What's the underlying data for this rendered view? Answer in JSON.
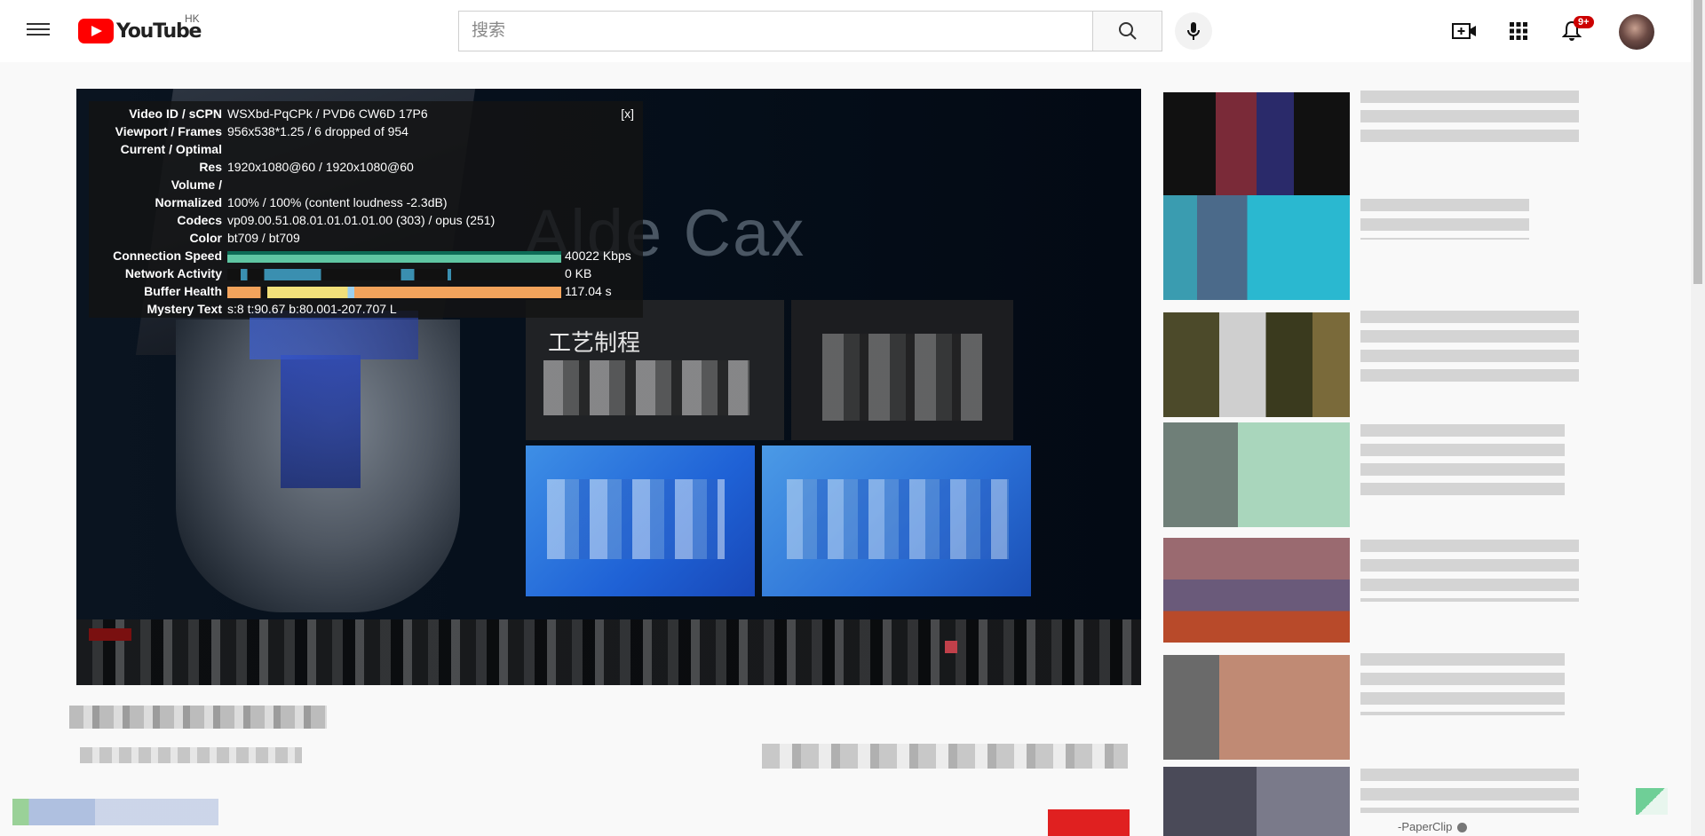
{
  "header": {
    "logo_text": "YouTube",
    "region_code": "HK",
    "search_placeholder": "搜索",
    "notification_count": "9+",
    "icons": [
      "menu-icon",
      "youtube-logo-icon",
      "search-icon",
      "mic-icon",
      "create-video-icon",
      "apps-grid-icon",
      "bell-icon",
      "avatar"
    ]
  },
  "player": {
    "overlay_text": "Alde Cax",
    "panel_label": "工艺制程"
  },
  "stats": {
    "close": "[x]",
    "rows": [
      {
        "key": "Video ID / sCPN",
        "value": "WSXbd-PqCPk / PVD6 CW6D 17P6"
      },
      {
        "key": "Viewport / Frames",
        "value": "956x538*1.25 / 6 dropped of 954"
      },
      {
        "key": "Current / Optimal",
        "value": ""
      },
      {
        "key": "Res",
        "value": "1920x1080@60 / 1920x1080@60"
      },
      {
        "key": "Volume /",
        "value": ""
      },
      {
        "key": "Normalized",
        "value": "100% / 100% (content loudness -2.3dB)"
      },
      {
        "key": "Codecs",
        "value": "vp09.00.51.08.01.01.01.01.00 (303) / opus (251)"
      },
      {
        "key": "Color",
        "value": "bt709 / bt709"
      },
      {
        "key": "Connection Speed",
        "value": "40022 Kbps"
      },
      {
        "key": "Network Activity",
        "value": "0 KB"
      },
      {
        "key": "Buffer Health",
        "value": "117.04 s"
      },
      {
        "key": "Mystery Text",
        "value": "s:8 t:90.67 b:80.001-207.707 L"
      }
    ]
  },
  "sidebar": {
    "last_channel": "-PaperClip"
  },
  "colors": {
    "brand_red": "#ff0000",
    "badge_red": "#cc0000",
    "connection_graph": "#5fc6a3",
    "network_graph": "#3a8fb0",
    "buffer_graph": "#f2a35c"
  }
}
